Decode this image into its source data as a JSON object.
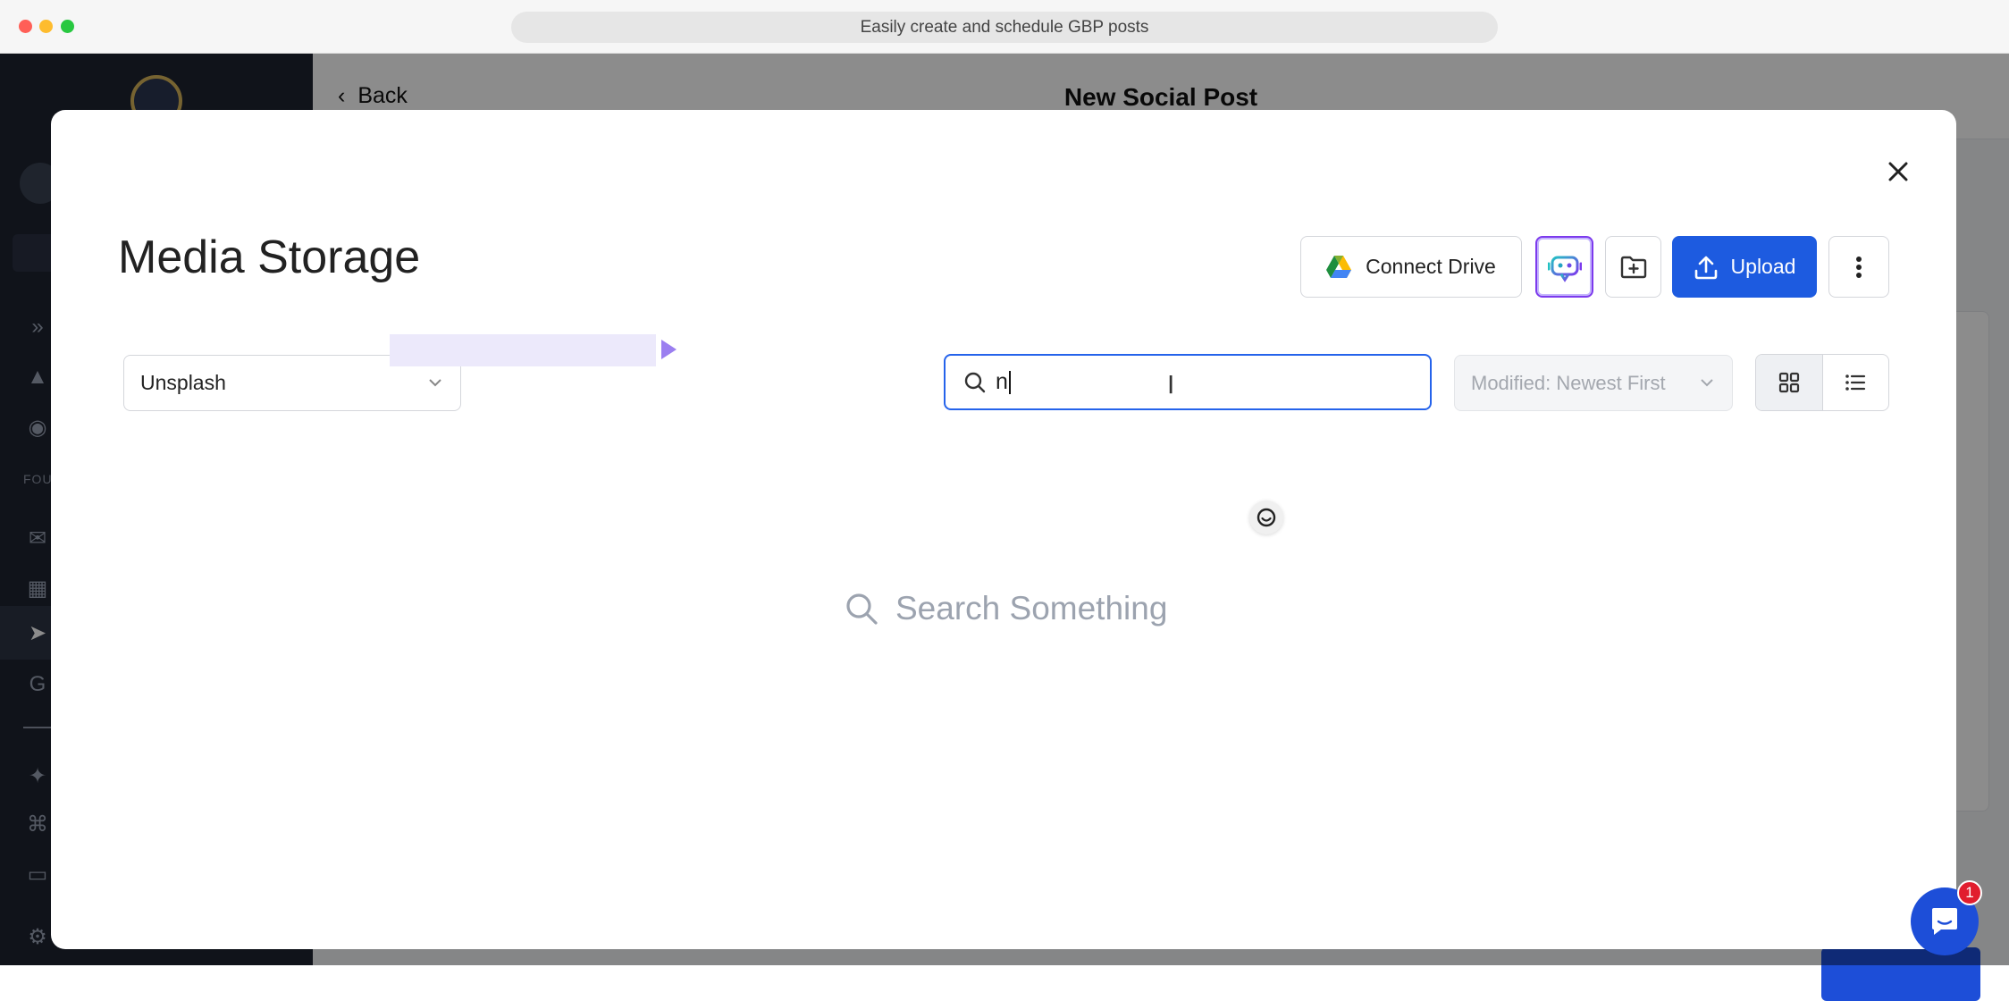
{
  "browser": {
    "tab_title": "Easily create and schedule GBP posts"
  },
  "background_app": {
    "back_label": "Back",
    "page_title": "New Social Post",
    "sidebar_section": "FOU"
  },
  "modal": {
    "title": "Media Storage",
    "actions": {
      "connect_drive_label": "Connect Drive",
      "ai_assistant_icon": "robot-icon",
      "new_folder_icon": "folder-plus-icon",
      "upload_label": "Upload",
      "more_icon": "kebab-menu-icon"
    },
    "source_select": {
      "value": "Unsplash"
    },
    "search": {
      "value": "n"
    },
    "sort_select": {
      "value": "Modified: Newest First"
    },
    "view_modes": [
      "grid",
      "list"
    ],
    "active_view": "grid",
    "empty_state": "Search Something"
  },
  "chat_widget": {
    "badge_count": "1"
  },
  "colors": {
    "primary": "#1d5be0",
    "focus_border": "#2563eb",
    "ai_border": "#7c3aed",
    "badge": "#e11d2e",
    "sidebar_bg": "#1e2330"
  }
}
